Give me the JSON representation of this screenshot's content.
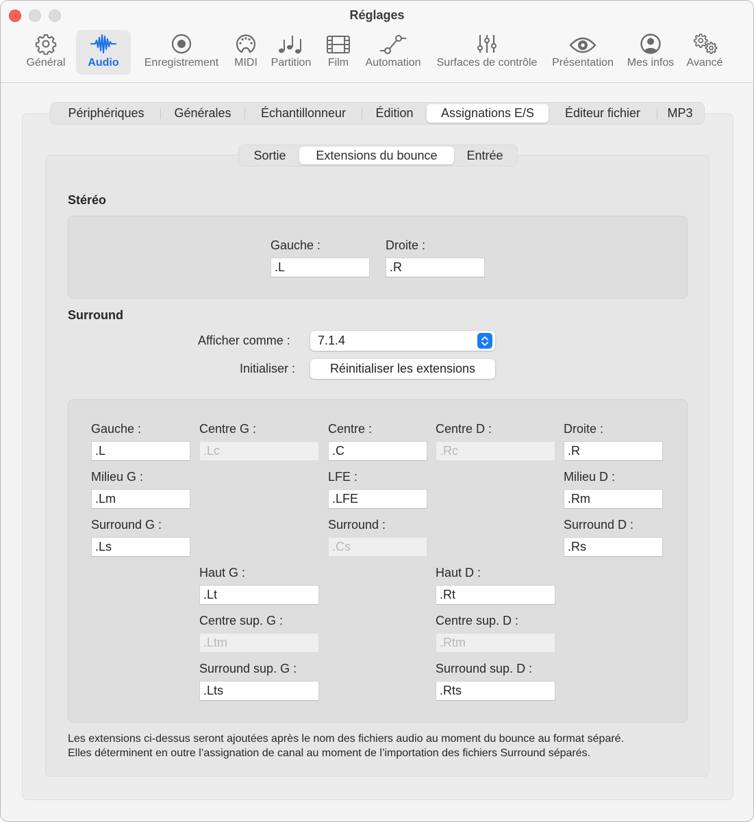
{
  "window": {
    "title": "Réglages",
    "traffic_lights": [
      "close",
      "minimize",
      "zoom"
    ]
  },
  "toolbar": {
    "items": [
      {
        "label": "Général",
        "icon": "gear-icon",
        "active": false
      },
      {
        "label": "Audio",
        "icon": "waveform-icon",
        "active": true
      },
      {
        "label": "Enregistrement",
        "icon": "record-icon",
        "active": false
      },
      {
        "label": "MIDI",
        "icon": "midi-connector-icon",
        "active": false
      },
      {
        "label": "Partition",
        "icon": "music-notes-icon",
        "active": false
      },
      {
        "label": "Film",
        "icon": "film-icon",
        "active": false
      },
      {
        "label": "Automation",
        "icon": "automation-curve-icon",
        "active": false
      },
      {
        "label": "Surfaces de contrôle",
        "icon": "sliders-icon",
        "active": false
      },
      {
        "label": "Présentation",
        "icon": "eye-icon",
        "active": false
      },
      {
        "label": "Mes infos",
        "icon": "person-circle-icon",
        "active": false
      },
      {
        "label": "Avancé",
        "icon": "gears-icon",
        "active": false
      }
    ],
    "active_color": "#1a6fe6"
  },
  "tabs": {
    "items": [
      "Périphériques",
      "Générales",
      "Échantillonneur",
      "Édition",
      "Assignations E/S",
      "Éditeur fichier",
      "MP3"
    ],
    "selected": "Assignations E/S"
  },
  "subtabs": {
    "items": [
      "Sortie",
      "Extensions du bounce",
      "Entrée"
    ],
    "selected": "Extensions du bounce"
  },
  "stereo": {
    "title": "Stéréo",
    "left_label": "Gauche :",
    "left_value": ".L",
    "right_label": "Droite :",
    "right_value": ".R"
  },
  "surround": {
    "title": "Surround",
    "display_as_label": "Afficher comme :",
    "display_as_value": "7.1.4",
    "init_label": "Initialiser :",
    "reset_button": "Réinitialiser les extensions",
    "fields": {
      "gauche": {
        "label": "Gauche :",
        "value": ".L",
        "enabled": true
      },
      "centre_g": {
        "label": "Centre G :",
        "value": ".Lc",
        "enabled": false
      },
      "centre": {
        "label": "Centre :",
        "value": ".C",
        "enabled": true
      },
      "centre_d": {
        "label": "Centre D :",
        "value": ".Rc",
        "enabled": false
      },
      "droite": {
        "label": "Droite :",
        "value": ".R",
        "enabled": true
      },
      "milieu_g": {
        "label": "Milieu G :",
        "value": ".Lm",
        "enabled": true
      },
      "lfe": {
        "label": "LFE :",
        "value": ".LFE",
        "enabled": true
      },
      "milieu_d": {
        "label": "Milieu D :",
        "value": ".Rm",
        "enabled": true
      },
      "surround_g": {
        "label": "Surround G :",
        "value": ".Ls",
        "enabled": true
      },
      "surround_c": {
        "label": "Surround :",
        "value": ".Cs",
        "enabled": false
      },
      "surround_d": {
        "label": "Surround D :",
        "value": ".Rs",
        "enabled": true
      },
      "haut_g": {
        "label": "Haut G :",
        "value": ".Lt",
        "enabled": true
      },
      "haut_d": {
        "label": "Haut D :",
        "value": ".Rt",
        "enabled": true
      },
      "centre_sup_g": {
        "label": "Centre sup. G :",
        "value": ".Ltm",
        "enabled": false
      },
      "centre_sup_d": {
        "label": "Centre sup. D :",
        "value": ".Rtm",
        "enabled": false
      },
      "surround_sup_g": {
        "label": "Surround sup. G :",
        "value": ".Lts",
        "enabled": true
      },
      "surround_sup_d": {
        "label": "Surround sup. D :",
        "value": ".Rts",
        "enabled": true
      }
    }
  },
  "note": {
    "line1": "Les extensions ci-dessus seront ajoutées après le nom des fichiers audio au moment du bounce au format séparé.",
    "line2": "Elles déterminent en outre l’assignation de canal au moment de l’importation des fichiers Surround séparés."
  }
}
